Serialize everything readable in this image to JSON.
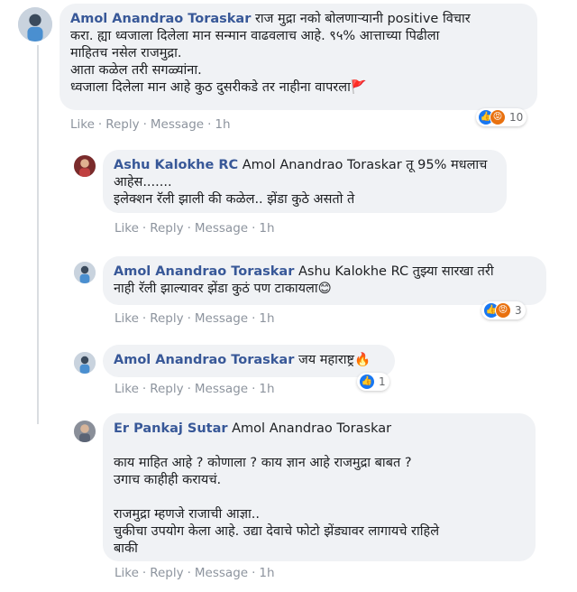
{
  "colors": {
    "name": "#385898",
    "bubble": "#f0f2f5",
    "muted": "#8d949e",
    "like": "#1877f2",
    "angry": "#e9710f"
  },
  "comments": [
    {
      "name": "Amol Anandrao Toraskar",
      "lines": [
        "राज मुद्रा नको बोलणाऱ्यानी positive विचार",
        "करा. ह्या ध्वजाला दिलेला मान सन्मान वाढवलाच आहे. ९५% आत्ताच्या पिढीला",
        "माहितच नसेल राजमुद्रा.",
        "आता कळेल तरी सगळ्यांना.",
        "ध्वजाला दिलेला मान आहे कुठ दुसरीकडे तर नाहीना वापरला🚩"
      ],
      "actions": {
        "like": "Like",
        "reply": "Reply",
        "message": "Message",
        "time": "1h"
      },
      "reactions": {
        "icons": [
          "like-icon",
          "angry-icon"
        ],
        "count": "10"
      }
    },
    {
      "name": "Ashu Kalokhe RC",
      "lines": [
        "Amol Anandrao Toraskar तू 95% मधलाच",
        "आहेस.......",
        "इलेक्शन रॅली झाली की कळेल.. झेंडा कुठे असतो ते"
      ],
      "actions": {
        "like": "Like",
        "reply": "Reply",
        "message": "Message",
        "time": "1h"
      }
    },
    {
      "name": "Amol Anandrao Toraskar",
      "lines": [
        "Ashu Kalokhe RC तुझ्या सारखा तरी",
        "नाही रॅली झाल्यावर झेंडा कुठं पण टाकायला😊"
      ],
      "actions": {
        "like": "Like",
        "reply": "Reply",
        "message": "Message",
        "time": "1h"
      },
      "reactions": {
        "icons": [
          "like-icon",
          "angry-icon"
        ],
        "count": "3"
      }
    },
    {
      "name": "Amol Anandrao Toraskar",
      "lines": [
        "जय महाराष्ट्र🔥"
      ],
      "actions": {
        "like": "Like",
        "reply": "Reply",
        "message": "Message",
        "time": "1h"
      },
      "reactions": {
        "icons": [
          "like-icon"
        ],
        "count": "1"
      }
    },
    {
      "name": "Er Pankaj Sutar",
      "lines": [
        "Amol Anandrao Toraskar",
        "",
        "काय माहित आहे ? कोणाला ? काय ज्ञान आहे राजमुद्रा बाबत ?",
        "उगाच काहीही करायचं.",
        "",
        "राजमुद्रा म्हणजे राजाची आज्ञा..",
        "चुकीचा उपयोग केला आहे. उद्या देवाचे फोटो झेंड्यावर लागायचे राहिले",
        "बाकी"
      ],
      "actions": {
        "like": "Like",
        "reply": "Reply",
        "message": "Message",
        "time": "1h"
      }
    }
  ]
}
